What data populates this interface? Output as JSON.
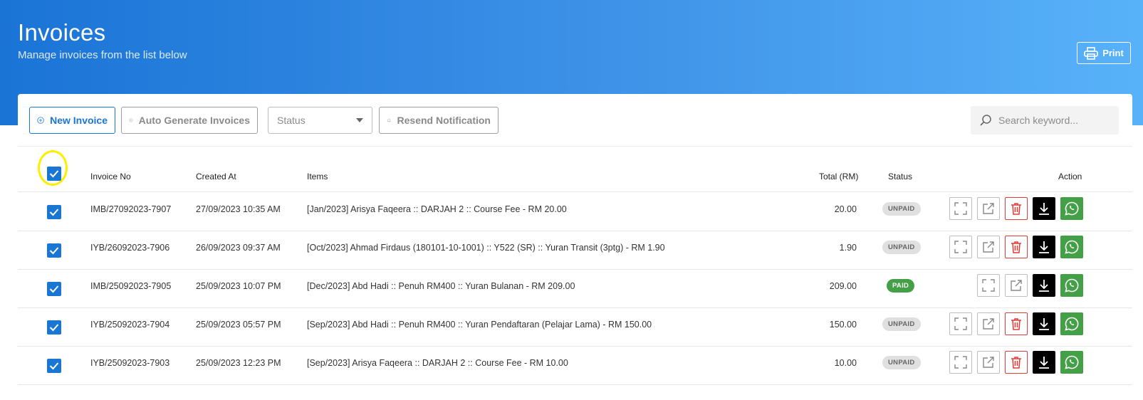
{
  "header": {
    "title": "Invoices",
    "subtitle": "Manage invoices from the list below",
    "print_label": "Print"
  },
  "toolbar": {
    "new_invoice_label": "New Invoice",
    "auto_generate_label": "Auto Generate Invoices",
    "status_select_value": "Status",
    "resend_label": "Resend Notification",
    "search_placeholder": "Search keyword..."
  },
  "table": {
    "headers": {
      "invoice_no": "Invoice No",
      "created_at": "Created At",
      "items": "Items",
      "total": "Total (RM)",
      "status": "Status",
      "action": "Action"
    },
    "rows": [
      {
        "invoice_no": "IMB/27092023-7907",
        "created_at": "27/09/2023 10:35 AM",
        "items": "[Jan/2023] Arisya Faqeera :: DARJAH 2 :: Course Fee - RM 20.00",
        "total": "20.00",
        "status": "UNPAID"
      },
      {
        "invoice_no": "IYB/26092023-7906",
        "created_at": "26/09/2023 09:37 AM",
        "items": "[Oct/2023] Ahmad Firdaus (180101-10-1001) :: Y522 (SR) :: Yuran Transit (3ptg) - RM 1.90",
        "total": "1.90",
        "status": "UNPAID"
      },
      {
        "invoice_no": "IMB/25092023-7905",
        "created_at": "25/09/2023 10:07 PM",
        "items": "[Dec/2023] Abd Hadi :: Penuh RM400 :: Yuran Bulanan - RM 209.00",
        "total": "209.00",
        "status": "PAID"
      },
      {
        "invoice_no": "IYB/25092023-7904",
        "created_at": "25/09/2023 05:57 PM",
        "items": "[Sep/2023] Abd Hadi :: Penuh RM400 :: Yuran Pendaftaran (Pelajar Lama) - RM 150.00",
        "total": "150.00",
        "status": "UNPAID"
      },
      {
        "invoice_no": "IYB/25092023-7903",
        "created_at": "25/09/2023 12:23 PM",
        "items": "[Sep/2023] Arisya Faqeera :: DARJAH 2 :: Course Fee - RM 10.00",
        "total": "10.00",
        "status": "UNPAID"
      }
    ]
  },
  "colors": {
    "primary": "#1976d2",
    "paid": "#43a047",
    "delete": "#e53935",
    "highlight": "#ffee00"
  }
}
